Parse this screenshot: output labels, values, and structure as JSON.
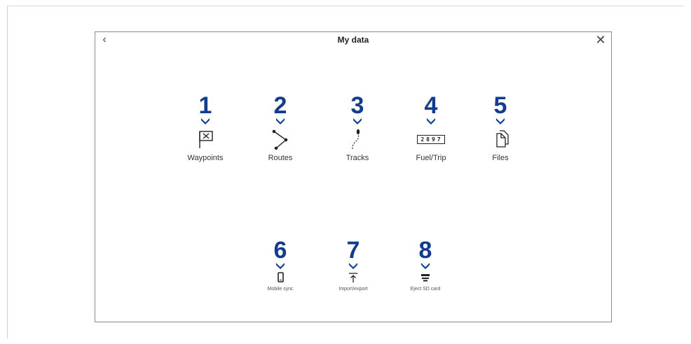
{
  "header": {
    "title": "My data",
    "back_icon": "chevron-left-icon",
    "close_icon": "close-icon"
  },
  "colors": {
    "callout": "#123d8f"
  },
  "items": [
    {
      "number": "1",
      "label": "Waypoints",
      "icon": "waypoint-flag-icon"
    },
    {
      "number": "2",
      "label": "Routes",
      "icon": "route-icon"
    },
    {
      "number": "3",
      "label": "Tracks",
      "icon": "track-icon"
    },
    {
      "number": "4",
      "label": "Fuel/Trip",
      "icon": "trip-counter-icon",
      "counter": "2897"
    },
    {
      "number": "5",
      "label": "Files",
      "icon": "files-icon"
    },
    {
      "number": "6",
      "label": "Mobile sync",
      "icon": "mobile-phone-icon"
    },
    {
      "number": "7",
      "label": "Import/export",
      "icon": "import-export-icon"
    },
    {
      "number": "8",
      "label": "Eject SD card",
      "icon": "eject-sd-card-icon"
    }
  ]
}
